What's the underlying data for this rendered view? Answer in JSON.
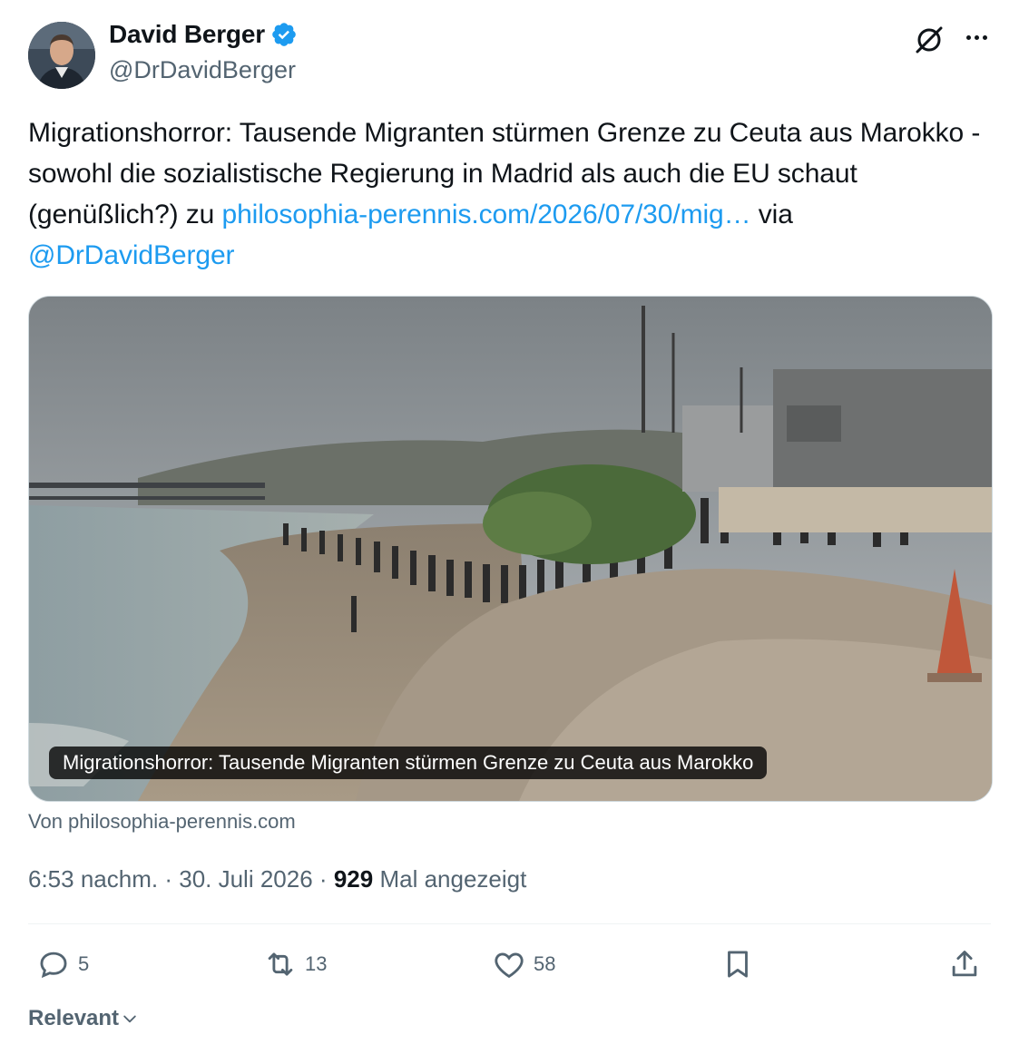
{
  "author": {
    "display_name": "David Berger",
    "handle": "@DrDavidBerger",
    "verified": true,
    "avatar_icon": "person-avatar"
  },
  "header_icons": [
    "grok-icon",
    "more-options-icon"
  ],
  "tweet": {
    "text_part1": "Migrationshorror: Tausende Migranten stürmen Grenze zu Ceuta aus Marokko - sowohl die sozialistische Regierung in Madrid als auch die EU schaut (genüßlich?) zu ",
    "link_text": "philosophia-perennis.com/2026/07/30/mig…",
    "text_part2": " via ",
    "mention": "@DrDavidBerger"
  },
  "media": {
    "caption": "Migrationshorror: Tausende Migranten stürmen Grenze zu Ceuta aus Marokko",
    "source": "Von philosophia-perennis.com"
  },
  "meta": {
    "time": "6:53 nachm.",
    "separator": "·",
    "date": "30. Juli 2026",
    "views_count": "929",
    "views_label": "Mal angezeigt"
  },
  "actions": {
    "reply_count": "5",
    "retweet_count": "13",
    "like_count": "58"
  },
  "sort": {
    "label": "Relevant"
  },
  "colors": {
    "link": "#1d9bf0",
    "verified": "#1d9bf0",
    "secondary_text": "#536471",
    "primary_text": "#0f1419"
  }
}
